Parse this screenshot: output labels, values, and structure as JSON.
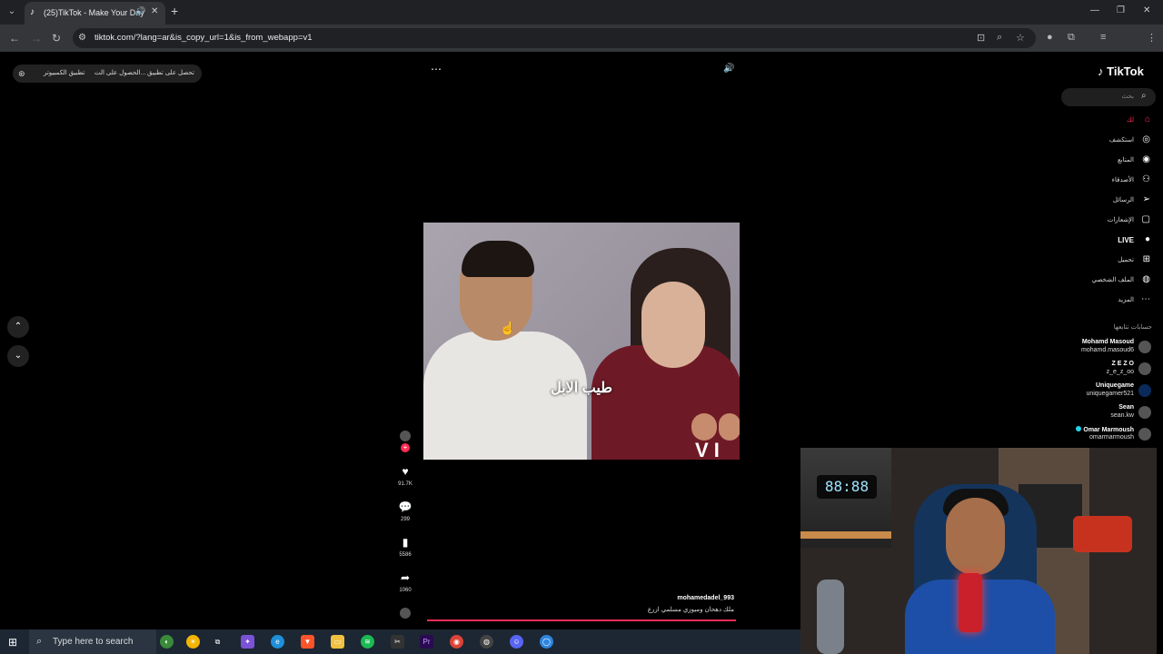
{
  "browser": {
    "tab_title": "(25)TikTok - Make Your Day",
    "url": "tiktok.com/?lang=ar&is_copy_url=1&is_from_webapp=v1",
    "profile_initial": "h"
  },
  "topbar": {
    "get_app": "تحصل على تطبيق",
    "get_coins": "الحصول على الت...",
    "install_pc": "تطبيق الكمبيوتر"
  },
  "video": {
    "caption": "طيب الابل",
    "badge_text": "V I",
    "author": "mohamedadel_993",
    "description": "ملك دهحان وميوزي مسلمي ازرع"
  },
  "actions": {
    "likes": "91.7K",
    "comments": "299",
    "saves": "5586",
    "shares": "1060"
  },
  "sidebar": {
    "logo": "TikTok",
    "search_placeholder": "بحث",
    "items": [
      {
        "label": "لك",
        "icon": "home-icon"
      },
      {
        "label": "استكشف",
        "icon": "compass-icon"
      },
      {
        "label": "المتابع",
        "icon": "following-icon"
      },
      {
        "label": "الأصدقاء",
        "icon": "friends-icon"
      },
      {
        "label": "الرسائل",
        "icon": "messages-icon"
      },
      {
        "label": "الإشعارات",
        "icon": "inbox-icon"
      },
      {
        "label": "LIVE",
        "icon": "live-icon"
      },
      {
        "label": "تحميل",
        "icon": "upload-icon"
      },
      {
        "label": "الملف الشخصي",
        "icon": "profile-icon"
      },
      {
        "label": "المزيد",
        "icon": "more-icon"
      }
    ],
    "following_header": "حسابات تتابعها",
    "following": [
      {
        "name": "Mohamd Masoud",
        "handle": "mohamd.masoud6"
      },
      {
        "name": "Z E Z O",
        "handle": "z_e_z_oo"
      },
      {
        "name": "Uniquegame",
        "handle": "uniquegamer521"
      },
      {
        "name": "Sean",
        "handle": "sean.kw"
      },
      {
        "name": "Omar Marmoush",
        "handle": "omarmarmoush"
      }
    ]
  },
  "webcam": {
    "clock": "88:88"
  },
  "taskbar": {
    "search_text": "Type here to search"
  },
  "colors": {
    "accent": "#fe2c55",
    "browser_bg": "#202124",
    "taskbar_bg": "#1c2733"
  }
}
